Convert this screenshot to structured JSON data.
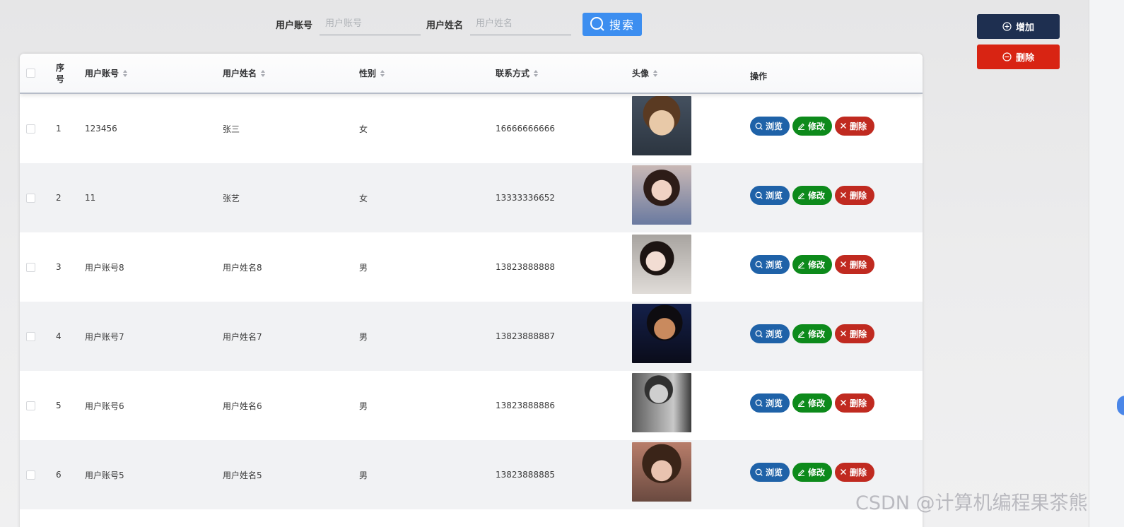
{
  "search": {
    "account_label": "用户账号",
    "account_placeholder": "用户账号",
    "name_label": "用户姓名",
    "name_placeholder": "用户姓名",
    "search_button": "搜索"
  },
  "side": {
    "add_label": "增加",
    "delete_label": "删除"
  },
  "table": {
    "headers": {
      "index": "序号",
      "account": "用户账号",
      "name": "用户姓名",
      "gender": "性别",
      "contact": "联系方式",
      "avatar": "头像",
      "actions": "操作"
    },
    "actions": {
      "view": "浏览",
      "edit": "修改",
      "delete": "删除"
    },
    "rows": [
      {
        "index": "1",
        "account": "123456",
        "name": "张三",
        "gender": "女",
        "contact": "16666666666"
      },
      {
        "index": "2",
        "account": "11",
        "name": "张艺",
        "gender": "女",
        "contact": "13333336652"
      },
      {
        "index": "3",
        "account": "用户账号8",
        "name": "用户姓名8",
        "gender": "男",
        "contact": "13823888888"
      },
      {
        "index": "4",
        "account": "用户账号7",
        "name": "用户姓名7",
        "gender": "男",
        "contact": "13823888887"
      },
      {
        "index": "5",
        "account": "用户账号6",
        "name": "用户姓名6",
        "gender": "男",
        "contact": "13823888886"
      },
      {
        "index": "6",
        "account": "用户账号5",
        "name": "用户姓名5",
        "gender": "男",
        "contact": "13823888885"
      }
    ]
  },
  "watermark": "CSDN @计算机编程果茶熊",
  "colors": {
    "search_button": "#3c8ef0",
    "add_button": "#1e2f50",
    "delete_button": "#d82413",
    "view_button": "#1f62a8",
    "edit_button": "#0d8a1b",
    "row_delete_button": "#c02a20"
  }
}
